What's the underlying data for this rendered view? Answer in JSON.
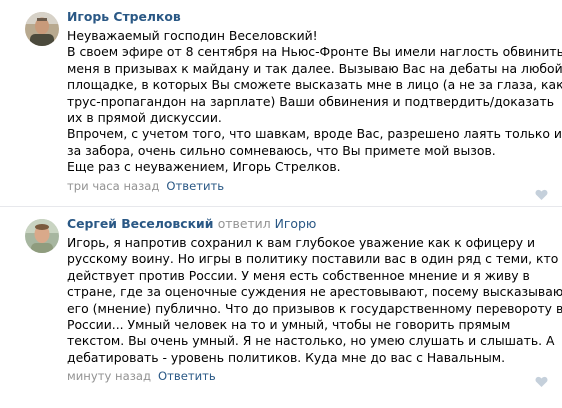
{
  "comments": [
    {
      "author": "Игорь Стрелков",
      "lines": [
        "Неуважаемый господин Веселовский!",
        "В своем эфире от 8 сентября на Ньюс-Фронте Вы имели наглость обвинить",
        "меня в призывах к майдану и так далее. Вызываю Вас на дебаты на любой",
        "площадке, в которых Вы сможете высказать мне в лицо (а не за глаза, как",
        "трус-пропагандон на зарплате) Ваши обвинения и подтвердить/доказать",
        "их в прямой дискуссии.",
        "Впрочем, с учетом того, что шавкам, вроде Вас, разрешено лаять только из-",
        "за забора, очень сильно сомневаюсь, что Вы примете мой вызов.",
        "Еще раз с неуважением, Игорь Стрелков."
      ],
      "time": "три часа назад",
      "reply_label": "Ответить",
      "like_icon": "heart-icon"
    },
    {
      "author": "Сергей Веселовский",
      "replied_word": "ответил",
      "replied_to": "Игорю",
      "lines": [
        "Игорь, я напротив сохранил к вам глубокое уважение как к офицеру и",
        "русскому воину. Но игры в политику поставили вас в один ряд с теми, кто",
        "действует против России. У меня есть собственное мнение и я живу в",
        "стране, где за оценочные суждения не арестовывают, посему высказываю",
        "его (мнение) публично. Что до призывов к государственному перевороту в",
        "России... Умный человек на то и умный, чтобы не говорить прямым",
        "текстом. Вы очень умный. Я не настолько, но умею слушать и слышать. А",
        "дебатировать - уровень политиков. Куда мне до вас с Навальным."
      ],
      "time": "минуту назад",
      "reply_label": "Ответить",
      "like_icon": "heart-icon"
    }
  ],
  "colors": {
    "link": "#2a5885",
    "meta": "#939393",
    "divider": "#e7e8ec",
    "text": "#000000"
  }
}
